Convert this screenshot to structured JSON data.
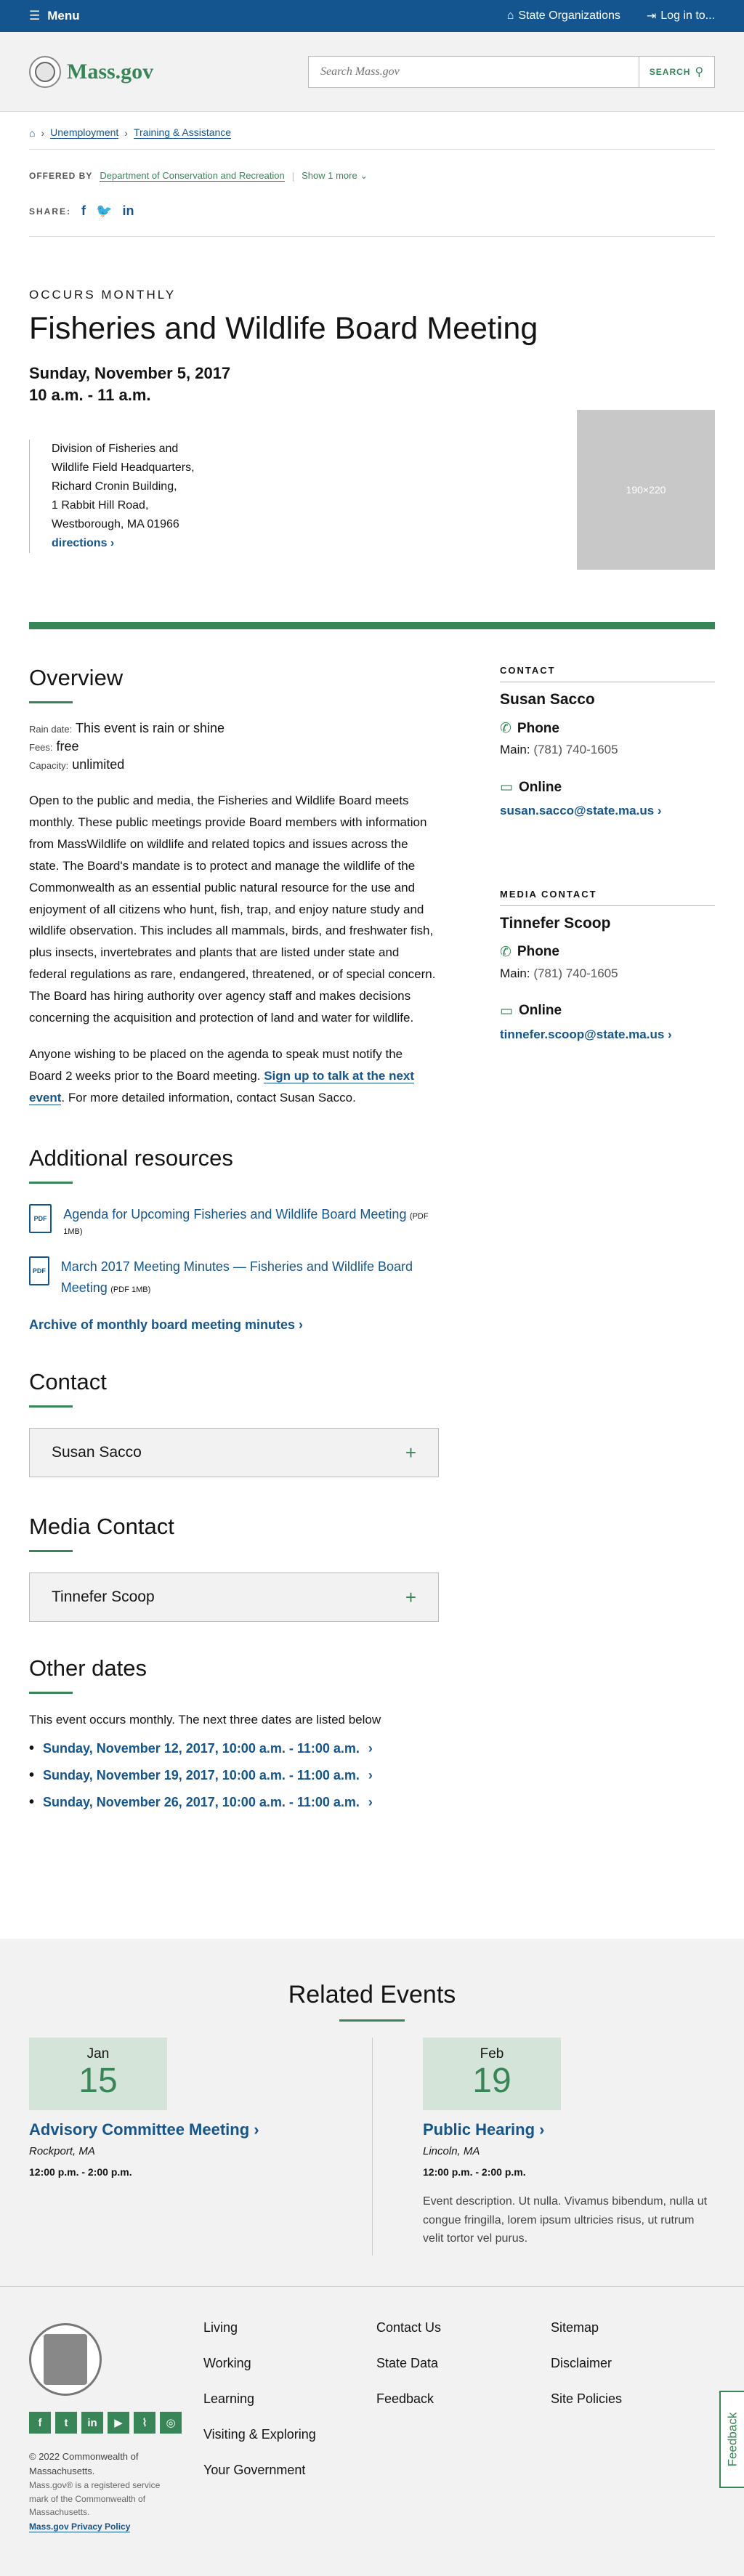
{
  "topbar": {
    "menu": "Menu",
    "state_orgs": "State Organizations",
    "login": "Log in to..."
  },
  "header": {
    "logo_text": "Mass.gov",
    "search_placeholder": "Search Mass.gov",
    "search_button": "SEARCH"
  },
  "breadcrumb": [
    "Unemployment",
    "Training & Assistance"
  ],
  "offered": {
    "label": "OFFERED BY",
    "org": "Department of Conservation and Recreation",
    "more": "Show 1 more"
  },
  "share": {
    "label": "SHARE:"
  },
  "hero": {
    "occurs": "OCCURS MONTHLY",
    "title": "Fisheries and Wildlife Board Meeting",
    "date": "Sunday, November 5, 2017",
    "time": "10 a.m. - 11 a.m.",
    "photo_placeholder": "190×220",
    "address": [
      "Division of Fisheries and Wildlife Field Headquarters, Richard Cronin Building,",
      "1 Rabbit Hill Road,",
      "Westborough, MA 01966"
    ],
    "directions": "directions"
  },
  "overview": {
    "heading": "Overview",
    "rain_label": "Rain date:",
    "rain_value": "This event is rain or shine",
    "fees_label": "Fees:",
    "fees_value": "free",
    "capacity_label": "Capacity:",
    "capacity_value": "unlimited",
    "p1": "Open to the public and media, the Fisheries and Wildlife Board meets monthly. These public meetings provide Board members with information from MassWildlife on wildlife and related topics and issues across the state. The Board's mandate is to protect and manage the wildlife of the Commonwealth as an essential public natural resource for the use and enjoyment of all citizens who hunt, fish, trap, and enjoy nature study and wildlife observation. This includes all mammals, birds, and freshwater fish, plus insects, invertebrates and plants that are listed under state and federal regulations as rare, endangered, threatened, or of special concern. The Board has hiring authority over agency staff and makes decisions concerning the acquisition and protection of land and water for wildlife.",
    "p2_before": "Anyone wishing to be placed on the agenda to speak must notify the Board 2 weeks prior to the Board meeting.",
    "p2_link": "Sign up to talk at the next event",
    "p2_after": ". For more detailed information, contact Susan Sacco."
  },
  "resources": {
    "heading": "Additional resources",
    "items": [
      {
        "title": "Agenda for Upcoming Fisheries and Wildlife Board Meeting",
        "size": "(PDF 1MB)"
      },
      {
        "title": "March 2017 Meeting Minutes — Fisheries and Wildlife Board Meeting",
        "size": "(PDF 1MB)"
      }
    ],
    "archive": "Archive of monthly board meeting minutes"
  },
  "contact": {
    "heading": "Contact",
    "name": "Susan Sacco"
  },
  "media_contact": {
    "heading": "Media Contact",
    "name": "Tinnefer Scoop"
  },
  "other_dates": {
    "heading": "Other dates",
    "intro": "This event occurs monthly. The next three dates are listed below",
    "dates": [
      "Sunday, November 12, 2017, 10:00 a.m. - 11:00 a.m.",
      "Sunday, November 19, 2017, 10:00 a.m. - 11:00 a.m.",
      "Sunday, November 26, 2017, 10:00 a.m. - 11:00 a.m."
    ]
  },
  "sidebar": {
    "contact_label": "CONTACT",
    "contact_name": "Susan Sacco",
    "phone_head": "Phone",
    "main_label": "Main:",
    "contact_phone": "(781) 740-1605",
    "online_head": "Online",
    "contact_email": "susan.sacco@state.ma.us",
    "media_label": "MEDIA CONTACT",
    "media_name": "Tinnefer Scoop",
    "media_phone": "(781) 740-1605",
    "media_email": "tinnefer.scoop@state.ma.us"
  },
  "related": {
    "heading": "Related Events",
    "events": [
      {
        "month": "Jan",
        "day": "15",
        "title": "Advisory Committee Meeting",
        "location": "Rockport, MA",
        "time": "12:00 p.m. - 2:00 p.m.",
        "desc": ""
      },
      {
        "month": "Feb",
        "day": "19",
        "title": "Public Hearing",
        "location": "Lincoln, MA",
        "time": "12:00 p.m. - 2:00 p.m.",
        "desc": "Event description. Ut nulla. Vivamus bibendum, nulla ut congue fringilla, lorem ipsum ultricies risus, ut rutrum velit tortor vel purus."
      }
    ]
  },
  "footer": {
    "col1": [
      "Living",
      "Working",
      "Learning",
      "Visiting & Exploring",
      "Your Government"
    ],
    "col2": [
      "Contact Us",
      "State Data",
      "Feedback"
    ],
    "col3": [
      "Sitemap",
      "Disclaimer",
      "Site Policies"
    ],
    "copyright": "© 2022 Commonwealth of Massachusetts.",
    "trademark": "Mass.gov® is a registered service mark of the Commonwealth of Massachusetts.",
    "privacy": "Mass.gov Privacy Policy",
    "feedback_tab": "Feedback"
  }
}
